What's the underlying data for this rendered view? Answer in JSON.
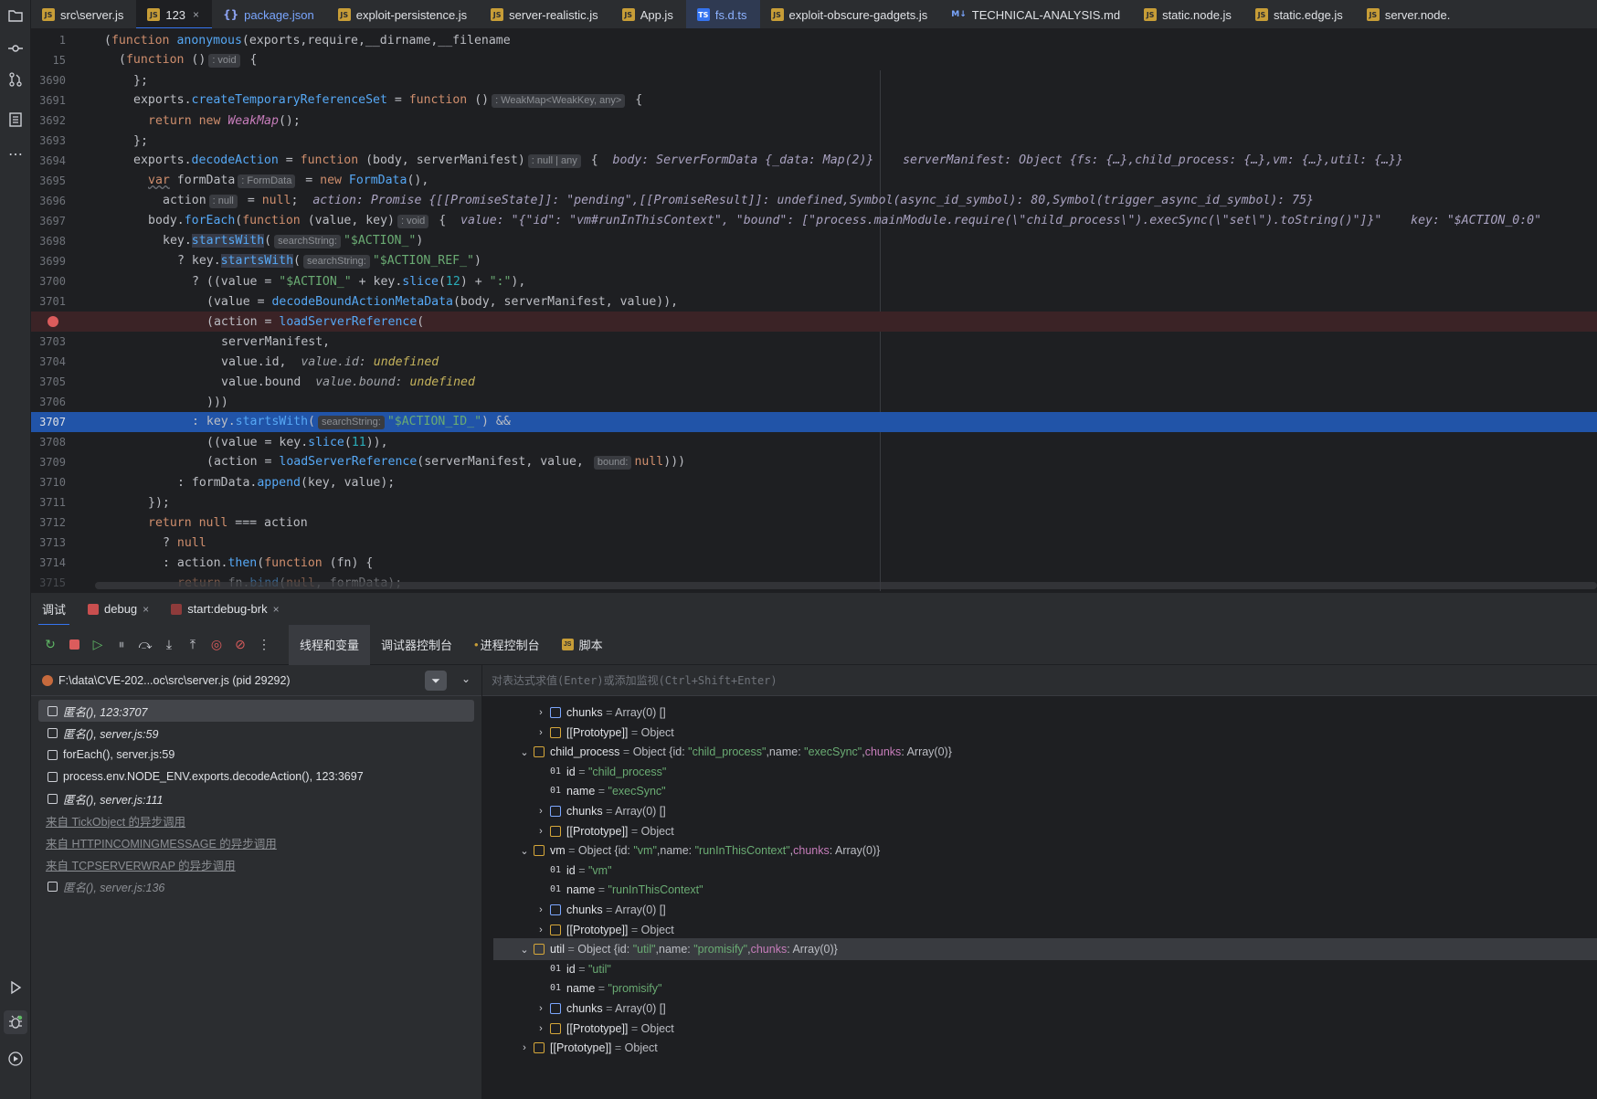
{
  "tabs": [
    {
      "label": "src\\server.js",
      "icon": "js-file-icon",
      "kind": "js"
    },
    {
      "label": "123",
      "icon": "js-file-icon",
      "kind": "js",
      "active": true,
      "close": "×"
    },
    {
      "label": "package.json",
      "icon": "json-file-icon",
      "kind": "json",
      "glyph": "{}"
    },
    {
      "label": "exploit-persistence.js",
      "icon": "js-file-icon",
      "kind": "js"
    },
    {
      "label": "server-realistic.js",
      "icon": "js-file-icon",
      "kind": "js"
    },
    {
      "label": "App.js",
      "icon": "js-file-icon",
      "kind": "js"
    },
    {
      "label": "fs.d.ts",
      "icon": "ts-file-icon",
      "kind": "ts"
    },
    {
      "label": "exploit-obscure-gadgets.js",
      "icon": "js-file-icon",
      "kind": "js"
    },
    {
      "label": "TECHNICAL-ANALYSIS.md",
      "icon": "markdown-file-icon",
      "kind": "md",
      "glyph": "M↓"
    },
    {
      "label": "static.node.js",
      "icon": "js-file-icon",
      "kind": "js"
    },
    {
      "label": "static.edge.js",
      "icon": "js-file-icon",
      "kind": "js"
    },
    {
      "label": "server.node.",
      "icon": "js-file-icon",
      "kind": "js"
    }
  ],
  "sticky": [
    {
      "num": "1"
    },
    {
      "num": "15"
    }
  ],
  "lines": [
    {
      "num": "3690"
    },
    {
      "num": "3691"
    },
    {
      "num": "3692"
    },
    {
      "num": "3693"
    },
    {
      "num": "3694"
    },
    {
      "num": "3695"
    },
    {
      "num": "3696"
    },
    {
      "num": "3697"
    },
    {
      "num": "3698"
    },
    {
      "num": "3699"
    },
    {
      "num": "3700"
    },
    {
      "num": "3701"
    },
    {
      "num": ""
    },
    {
      "num": "3703"
    },
    {
      "num": "3704"
    },
    {
      "num": "3705"
    },
    {
      "num": "3706"
    },
    {
      "num": "3707"
    },
    {
      "num": "3708"
    },
    {
      "num": "3709"
    },
    {
      "num": "3710"
    },
    {
      "num": "3711"
    },
    {
      "num": "3712"
    },
    {
      "num": "3713"
    },
    {
      "num": "3714"
    },
    {
      "num": "3715"
    }
  ],
  "debug_tabs": [
    {
      "label": "调试",
      "active": true
    },
    {
      "label": "debug",
      "close": "×"
    },
    {
      "label": "start:debug-brk",
      "close": "×"
    }
  ],
  "toolbar": {
    "subtabs": [
      {
        "label": "线程和变量",
        "active": true
      },
      {
        "label": "调试器控制台"
      },
      {
        "label": "进程控制台"
      },
      {
        "label": "脚本"
      }
    ]
  },
  "thread": {
    "label": "F:\\data\\CVE-202...oc\\src\\server.js (pid 29292)"
  },
  "frames": [
    {
      "label": "匿名(), 123:3707",
      "selected": true
    },
    {
      "label": "匿名(), server.js:59"
    },
    {
      "label": "forEach(), server.js:59"
    },
    {
      "label": "process.env.NODE_ENV.exports.decodeAction(), 123:3697"
    },
    {
      "label": "匿名(), server.js:111"
    },
    {
      "label": "来自 TickObject 的异步调用",
      "async": true
    },
    {
      "label": "来自 HTTPINCOMINGMESSAGE 的异步调用",
      "async": true
    },
    {
      "label": "来自 TCPSERVERWRAP 的异步调用",
      "async": true
    },
    {
      "label": "匿名(), server.js:136",
      "dim": true
    }
  ],
  "eval_placeholder": "对表达式求值(Enter)或添加监视(Ctrl+Shift+Enter)",
  "variables": [
    {
      "indent": 2,
      "arrow": "›",
      "icon": "arr",
      "name": "chunks",
      "eq": " = ",
      "type": "Array(0) []"
    },
    {
      "indent": 2,
      "arrow": "›",
      "icon": "obj",
      "name": "[[Prototype]]",
      "eq": " = ",
      "type": "Object"
    },
    {
      "indent": 1,
      "arrow": "⌄",
      "icon": "obj",
      "name": "child_process",
      "eq": " = ",
      "type": "Object {id: ",
      "s1": "\"child_process\"",
      "t2": ",name: ",
      "s2": "\"execSync\"",
      "t3": ",",
      "k3": "chunks",
      "t4": ": Array(0)}"
    },
    {
      "indent": 2,
      "arrow": "",
      "icon": "prim",
      "name": "id",
      "eq": " = ",
      "s1": "\"child_process\""
    },
    {
      "indent": 2,
      "arrow": "",
      "icon": "prim",
      "name": "name",
      "eq": " = ",
      "s1": "\"execSync\""
    },
    {
      "indent": 2,
      "arrow": "›",
      "icon": "arr",
      "name": "chunks",
      "eq": " = ",
      "type": "Array(0) []"
    },
    {
      "indent": 2,
      "arrow": "›",
      "icon": "obj",
      "name": "[[Prototype]]",
      "eq": " = ",
      "type": "Object"
    },
    {
      "indent": 1,
      "arrow": "⌄",
      "icon": "obj",
      "name": "vm",
      "eq": " = ",
      "type": "Object {id: ",
      "s1": "\"vm\"",
      "t2": ",name: ",
      "s2": "\"runInThisContext\"",
      "t3": ",",
      "k3": "chunks",
      "t4": ": Array(0)}"
    },
    {
      "indent": 2,
      "arrow": "",
      "icon": "prim",
      "name": "id",
      "eq": " = ",
      "s1": "\"vm\""
    },
    {
      "indent": 2,
      "arrow": "",
      "icon": "prim",
      "name": "name",
      "eq": " = ",
      "s1": "\"runInThisContext\""
    },
    {
      "indent": 2,
      "arrow": "›",
      "icon": "arr",
      "name": "chunks",
      "eq": " = ",
      "type": "Array(0) []"
    },
    {
      "indent": 2,
      "arrow": "›",
      "icon": "obj",
      "name": "[[Prototype]]",
      "eq": " = ",
      "type": "Object"
    },
    {
      "indent": 1,
      "arrow": "⌄",
      "icon": "obj",
      "name": "util",
      "eq": " = ",
      "type": "Object {id: ",
      "s1": "\"util\"",
      "t2": ",name: ",
      "s2": "\"promisify\"",
      "t3": ",",
      "k3": "chunks",
      "t4": ": Array(0)}",
      "selected": true
    },
    {
      "indent": 2,
      "arrow": "",
      "icon": "prim",
      "name": "id",
      "eq": " = ",
      "s1": "\"util\""
    },
    {
      "indent": 2,
      "arrow": "",
      "icon": "prim",
      "name": "name",
      "eq": " = ",
      "s1": "\"promisify\""
    },
    {
      "indent": 2,
      "arrow": "›",
      "icon": "arr",
      "name": "chunks",
      "eq": " = ",
      "type": "Array(0) []"
    },
    {
      "indent": 2,
      "arrow": "›",
      "icon": "obj",
      "name": "[[Prototype]]",
      "eq": " = ",
      "type": "Object"
    },
    {
      "indent": 1,
      "arrow": "›",
      "icon": "obj",
      "name": "[[Prototype]]",
      "eq": " = ",
      "type": "Object"
    }
  ],
  "colors": {
    "accent": "#3574f0",
    "current_line": "#2154a8",
    "breakpoint": "#db5c5c",
    "bp_line": "#3b2326"
  }
}
